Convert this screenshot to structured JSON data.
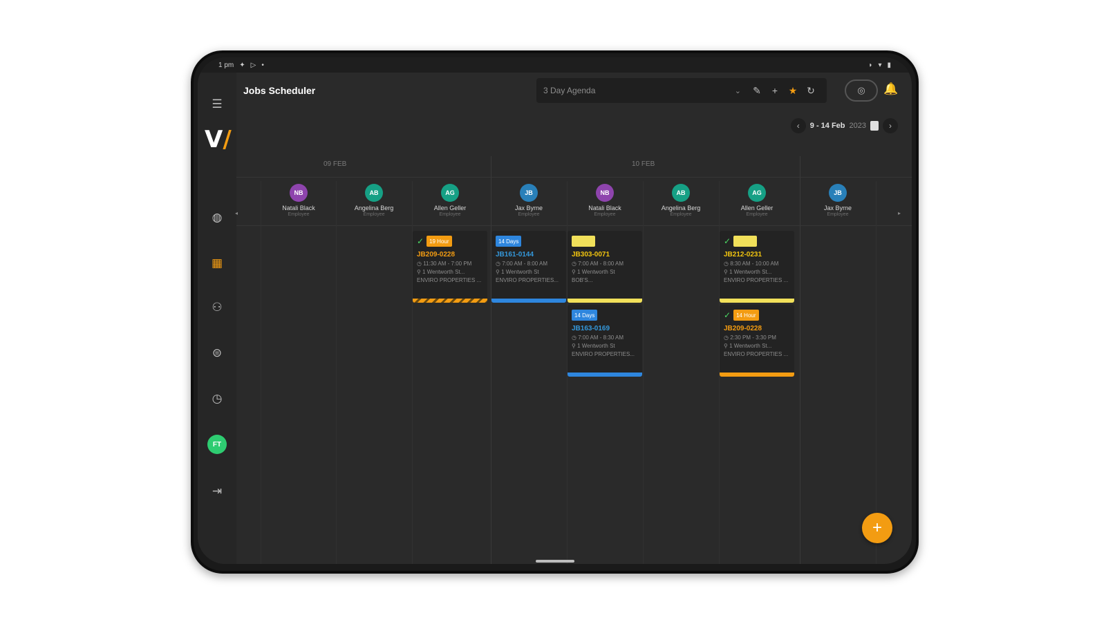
{
  "statusbar": {
    "time": "1 pm"
  },
  "header": {
    "title": "Jobs Scheduler"
  },
  "view_select": {
    "label": "3 Day Agenda"
  },
  "date_nav": {
    "range": "9 - 14 Feb",
    "year": "2023"
  },
  "days": [
    {
      "label": "09 FEB"
    },
    {
      "label": "10 FEB"
    }
  ],
  "employees": [
    {
      "initials": "NB",
      "name": "Natali Black",
      "role": "Employee",
      "color": "#8e44ad"
    },
    {
      "initials": "AB",
      "name": "Angelina Berg",
      "role": "Employee",
      "color": "#16a085"
    },
    {
      "initials": "AG",
      "name": "Allen Geller",
      "role": "Employee",
      "color": "#16a085"
    },
    {
      "initials": "JB",
      "name": "Jax Byrne",
      "role": "Employee",
      "color": "#2980b9"
    },
    {
      "initials": "NB",
      "name": "Natali Black",
      "role": "Employee",
      "color": "#8e44ad"
    },
    {
      "initials": "AB",
      "name": "Angelina Berg",
      "role": "Employee",
      "color": "#16a085"
    },
    {
      "initials": "AG",
      "name": "Allen Geller",
      "role": "Employee",
      "color": "#16a085"
    },
    {
      "initials": "JB",
      "name": "Jax Byrne",
      "role": "Employee",
      "color": "#2980b9"
    }
  ],
  "jobs": [
    {
      "id": "JB209-0228",
      "badge": "19 Hour",
      "badge_color": "#f39c12",
      "id_color": "#f39c12",
      "time": "11:30 AM - 7:00 PM",
      "address": "1 Wentworth St...",
      "client": "ENVIRO PROPERTIES ...",
      "bar_color": "#f39c12",
      "checked": true
    },
    {
      "id": "JB161-0144",
      "badge": "14 Days",
      "badge_color": "#2e86de",
      "id_color": "#3498db",
      "time": "7:00 AM - 8:00 AM",
      "address": "1 Wentworth St",
      "client": "ENVIRO PROPERTIES...",
      "bar_color": "#2e86de",
      "checked": false
    },
    {
      "id": "JB303-0071",
      "badge": "",
      "badge_color": "#f1e05a",
      "id_color": "#f1c40f",
      "time": "7:00 AM - 8:00 AM",
      "address": "1 Wentworth St",
      "client": "BOB'S...",
      "bar_color": "#f1e05a",
      "checked": false
    },
    {
      "id": "JB163-0169",
      "badge": "14 Days",
      "badge_color": "#2e86de",
      "id_color": "#3498db",
      "time": "7:00 AM - 8:30 AM",
      "address": "1 Wentworth St",
      "client": "ENVIRO PROPERTIES...",
      "bar_color": "#2e86de",
      "checked": false
    },
    {
      "id": "JB212-0231",
      "badge": "",
      "badge_color": "#f1e05a",
      "id_color": "#f1c40f",
      "time": "8:30 AM - 10:00 AM",
      "address": "1 Wentworth St...",
      "client": "ENVIRO PROPERTIES ...",
      "bar_color": "#f1e05a",
      "checked": true
    },
    {
      "id": "JB209-0228",
      "badge": "14 Hour",
      "badge_color": "#f39c12",
      "id_color": "#f39c12",
      "time": "2:30 PM - 3:30 PM",
      "address": "1 Wentworth St...",
      "client": "ENVIRO PROPERTIES ...",
      "bar_color": "#f39c12",
      "checked": true
    }
  ],
  "fab": {
    "label": "+"
  },
  "colors": {
    "accent": "#f39c12",
    "background": "#2a2a2a",
    "sidebar": "#262626"
  },
  "icons": {
    "menu": "menu-icon",
    "logo": "app-logo",
    "dashboard": "dashboard-icon",
    "calendar": "calendar-icon",
    "team": "team-icon",
    "money": "money-icon",
    "clock": "clock-icon",
    "logout": "logout-icon",
    "edit": "pencil-icon",
    "add": "plus-icon",
    "favorite": "star-icon",
    "refresh": "refresh-icon",
    "notifications": "bell-icon"
  }
}
